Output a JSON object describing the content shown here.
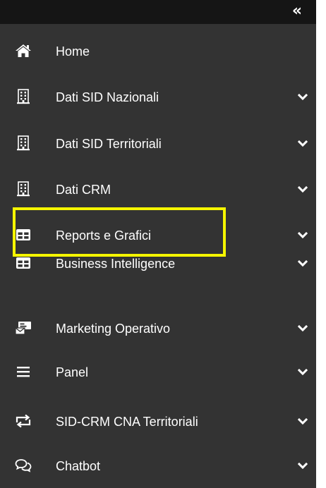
{
  "sidebar": {
    "collapse_label": "«",
    "items": [
      {
        "label": "Home",
        "icon": "home-icon",
        "has_submenu": false
      },
      {
        "label": "Dati SID Nazionali",
        "icon": "building-icon",
        "has_submenu": true
      },
      {
        "label": "Dati SID Territoriali",
        "icon": "building-icon",
        "has_submenu": true
      },
      {
        "label": "Dati CRM",
        "icon": "building-icon",
        "has_submenu": true
      },
      {
        "label": "Reports e Grafici",
        "icon": "table-icon",
        "has_submenu": true
      },
      {
        "label": "Business Intelligence",
        "icon": "table-icon",
        "has_submenu": true
      },
      {
        "label": "Marketing Operativo",
        "icon": "inbox-icon",
        "has_submenu": true
      },
      {
        "label": "Panel",
        "icon": "bars-icon",
        "has_submenu": true
      },
      {
        "label": "SID-CRM CNA Territoriali",
        "icon": "exchange-icon",
        "has_submenu": true
      },
      {
        "label": "Chatbot",
        "icon": "comments-icon",
        "has_submenu": true
      }
    ]
  },
  "colors": {
    "sidebar_bg": "#333333",
    "topbar_bg": "#151515",
    "text": "#ffffff",
    "highlight": "#f5f500"
  }
}
